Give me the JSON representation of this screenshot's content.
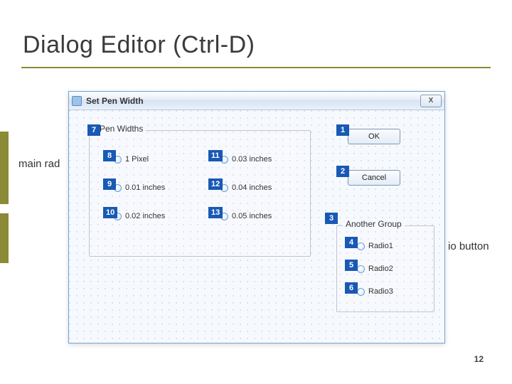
{
  "slide": {
    "title": "Dialog Editor (Ctrl-D)",
    "left_note": "main rad",
    "right_note": "io button",
    "page_number": "12"
  },
  "dialog": {
    "title": "Set Pen Width",
    "close_glyph": "X",
    "groups": {
      "pen": {
        "legend": "Pen Widths"
      },
      "another": {
        "legend": "Another Group"
      }
    },
    "radios_left": [
      {
        "label": "1 Pixel"
      },
      {
        "label": "0.01 inches"
      },
      {
        "label": "0.02 inches"
      }
    ],
    "radios_right": [
      {
        "label": "0.03 inches"
      },
      {
        "label": "0.04 inches"
      },
      {
        "label": "0.05 inches"
      }
    ],
    "radios_another": [
      {
        "label": "Radio1"
      },
      {
        "label": "Radio2"
      },
      {
        "label": "Radio3"
      }
    ],
    "buttons": {
      "ok": "OK",
      "cancel": "Cancel"
    }
  },
  "tabtags": {
    "t1": "1",
    "t2": "2",
    "t3": "3",
    "t4": "4",
    "t5": "5",
    "t6": "6",
    "t7": "7",
    "t8": "8",
    "t9": "9",
    "t10": "10",
    "t11": "11",
    "t12": "12",
    "t13": "13"
  }
}
